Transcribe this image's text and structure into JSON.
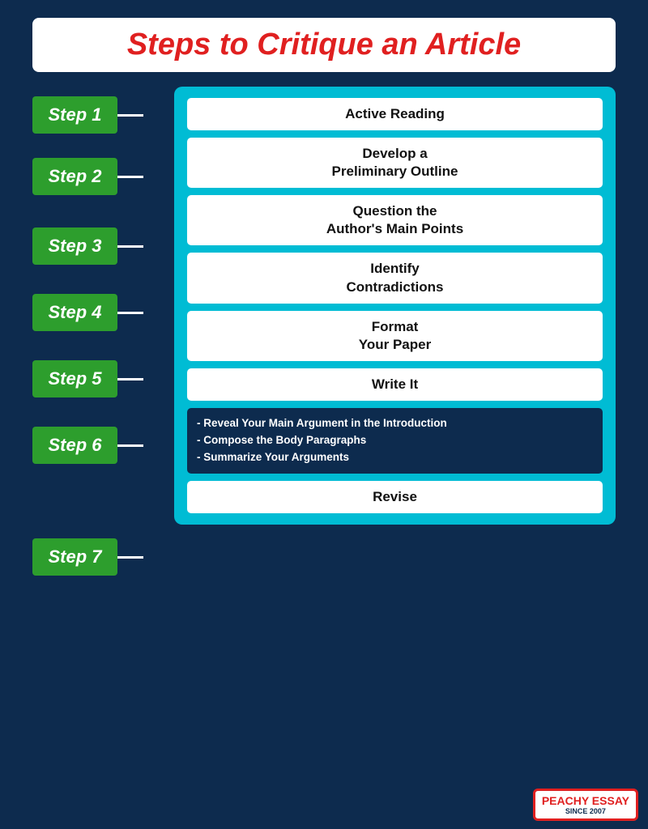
{
  "title": "Steps to Critique an Article",
  "steps": [
    {
      "label": "Step 1"
    },
    {
      "label": "Step 2"
    },
    {
      "label": "Step 3"
    },
    {
      "label": "Step 4"
    },
    {
      "label": "Step 5"
    },
    {
      "label": "Step 6"
    },
    {
      "label": "Step 7"
    }
  ],
  "items": [
    {
      "id": "active-reading",
      "text": "Active Reading",
      "dark": false
    },
    {
      "id": "preliminary-outline",
      "text": "Develop a\nPreliminary Outline",
      "dark": false
    },
    {
      "id": "question-author",
      "text": "Question the\nAuthor's Main Points",
      "dark": false
    },
    {
      "id": "identify-contradictions",
      "text": "Identify\nContradictions",
      "dark": false
    },
    {
      "id": "format-paper",
      "text": "Format\nYour Paper",
      "dark": false
    },
    {
      "id": "write-it",
      "text": "Write It",
      "dark": false
    },
    {
      "id": "write-it-sub",
      "text": "- Reveal Your Main Argument in\n  the Introduction\n- Compose the Body Paragraphs\n- Summarize Your Arguments",
      "dark": true
    },
    {
      "id": "revise",
      "text": "Revise",
      "dark": false
    }
  ],
  "logo": {
    "main": "PEACHY ESSAY",
    "sub": "SINCE 2007"
  }
}
